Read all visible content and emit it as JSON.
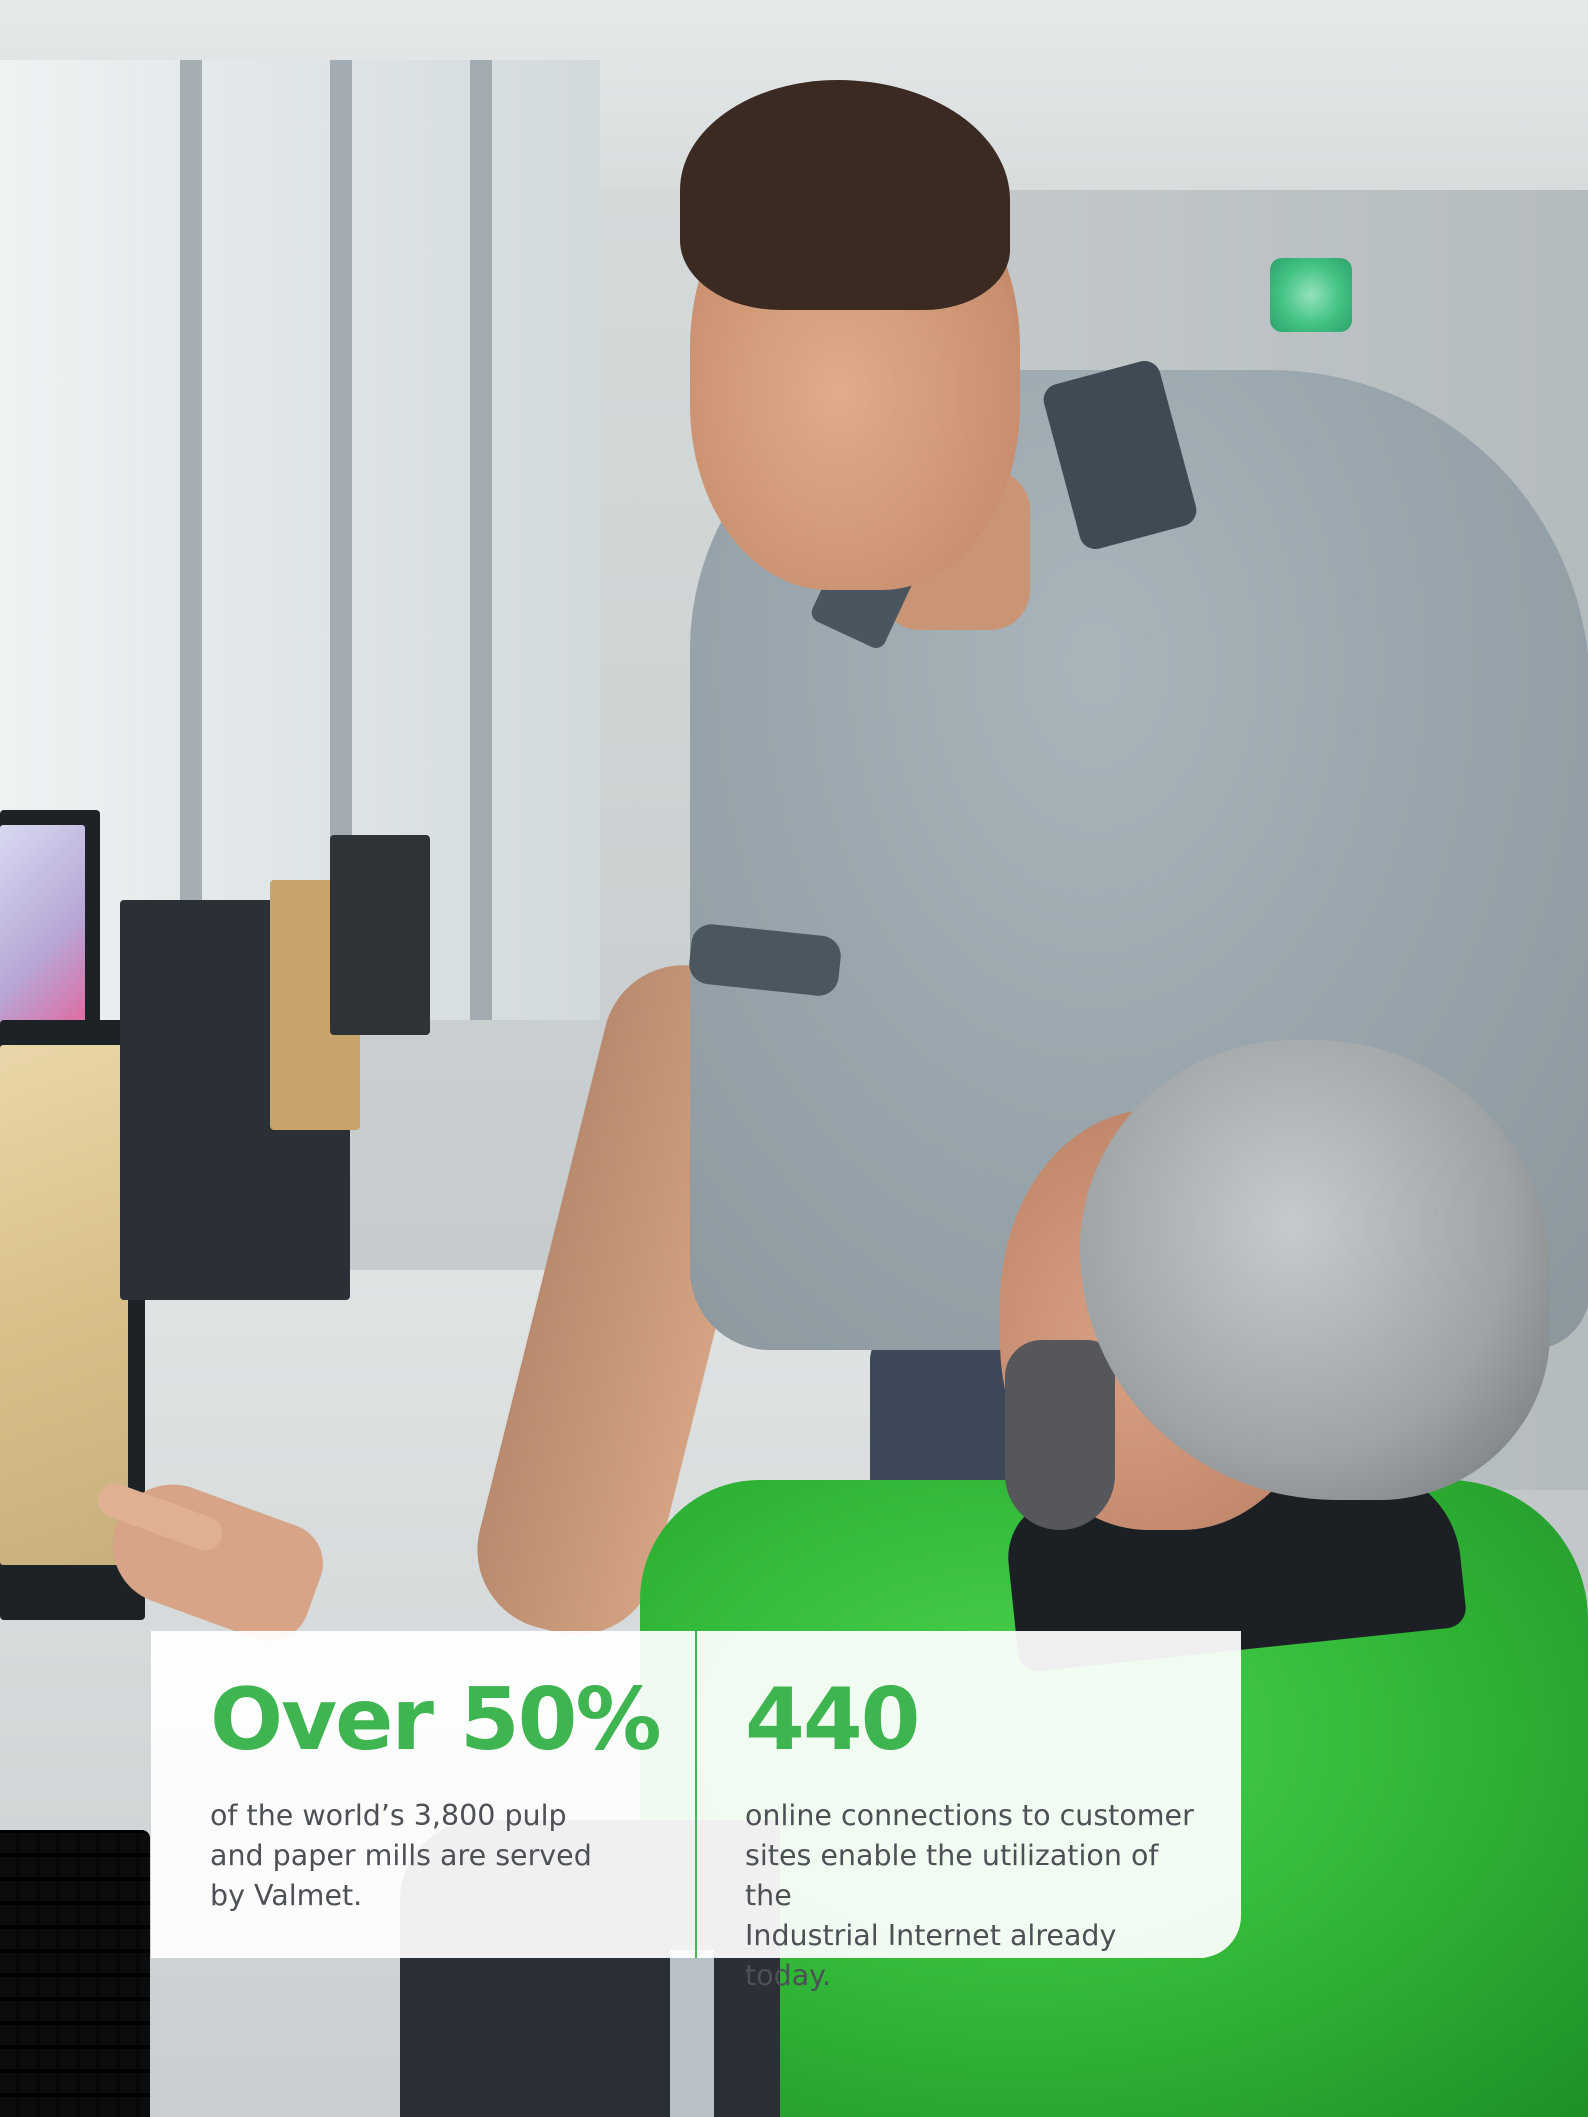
{
  "stats": [
    {
      "value": "Over 50%",
      "line1": "of the world’s 3,800 pulp",
      "line2": "and paper mills are served",
      "line3": "by Valmet."
    },
    {
      "value": "440",
      "line1": "online connections to customer",
      "line2": "sites enable the utilization of the",
      "line3": "Industrial Internet already today."
    }
  ],
  "colors": {
    "accent": "#3fb551",
    "body_text": "#4d5156",
    "card_background": "#ffffff"
  }
}
